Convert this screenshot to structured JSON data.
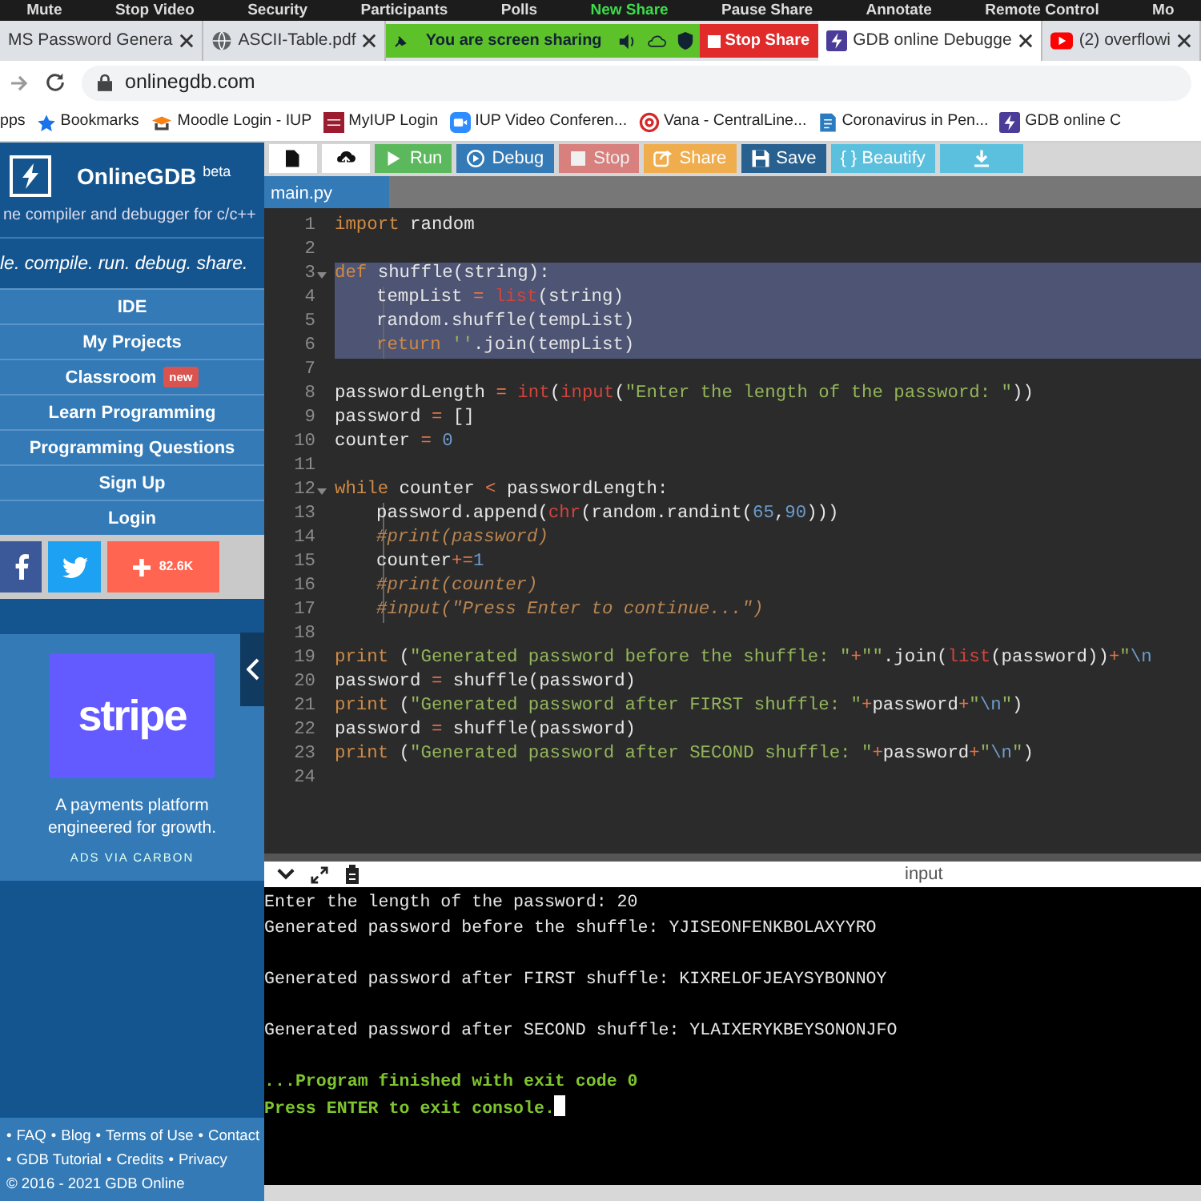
{
  "zoom_toolbar": {
    "items": [
      {
        "label": "Mute",
        "highlighted": false
      },
      {
        "label": "Stop Video",
        "highlighted": false
      },
      {
        "label": "Security",
        "highlighted": false
      },
      {
        "label": "Participants",
        "highlighted": false
      },
      {
        "label": "Polls",
        "highlighted": false
      },
      {
        "label": "New Share",
        "highlighted": true
      },
      {
        "label": "Pause Share",
        "highlighted": false
      },
      {
        "label": "Annotate",
        "highlighted": false
      },
      {
        "label": "Remote Control",
        "highlighted": false
      },
      {
        "label": "Mo",
        "highlighted": false
      }
    ]
  },
  "browser": {
    "tabs": [
      {
        "title": "MS Password Genera",
        "selected": false
      },
      {
        "title": "ASCII-Table.pdf",
        "selected": false
      },
      {
        "title": "GDB online Debugge",
        "selected": true
      },
      {
        "title": "(2) overflowi",
        "selected": false
      }
    ],
    "sharing_banner": {
      "message": "You are screen sharing",
      "stop_label": "Stop Share"
    },
    "address": {
      "url": "onlinegdb.com"
    },
    "bookmarks": [
      {
        "label": "pps"
      },
      {
        "label": "Bookmarks"
      },
      {
        "label": "Moodle Login - IUP"
      },
      {
        "label": "MyIUP Login"
      },
      {
        "label": "IUP Video Conferen..."
      },
      {
        "label": "Vana - CentralLine..."
      },
      {
        "label": "Coronavirus in Pen..."
      },
      {
        "label": "GDB online C"
      }
    ]
  },
  "sidebar": {
    "brand": "OnlineGDB $^{beta}$",
    "subtitle": "ne compiler and debugger for c/c++",
    "tagline": "le. compile. run. debug. share.",
    "menu": [
      {
        "label": "IDE"
      },
      {
        "label": "My Projects"
      },
      {
        "label": "Classroom",
        "tag": "new"
      },
      {
        "label": "Learn Programming"
      },
      {
        "label": "Programming Questions"
      },
      {
        "label": "Sign Up"
      },
      {
        "label": "Login"
      }
    ],
    "share_count": "82.6K",
    "ad": {
      "logo": "stripe",
      "text": "A payments platform engineered for growth.",
      "via": "ADS VIA CARBON"
    },
    "footer": {
      "bullet": "•",
      "rows": [
        {
          "links": [
            "FAQ",
            "Blog",
            "Terms of Use",
            "Contact"
          ]
        },
        {
          "links": [
            "GDB Tutorial",
            "Credits",
            "Privacy"
          ]
        }
      ],
      "copyright": "© 2016 - 2021 GDB Online"
    }
  },
  "editor": {
    "toolbar": [
      {
        "kind": "new",
        "disabled": false
      },
      {
        "kind": "upload",
        "disabled": false
      },
      {
        "kind": "run",
        "label": "Run",
        "disabled": false
      },
      {
        "kind": "debug",
        "label": "Debug",
        "disabled": false
      },
      {
        "kind": "stop",
        "label": "Stop",
        "disabled": true
      },
      {
        "kind": "share",
        "label": "Share",
        "disabled": false
      },
      {
        "kind": "save",
        "label": "Save",
        "disabled": false
      },
      {
        "kind": "beautify",
        "label": "{ } Beautify",
        "disabled": false
      },
      {
        "kind": "download",
        "disabled": false
      }
    ],
    "file_tabs": [
      {
        "name": "main.py",
        "selected": true
      }
    ],
    "code": {
      "lines": [
        {
          "number": "1",
          "selected": false,
          "foldable": false,
          "indented": false,
          "tokens": [
            {
              "kind": "kw",
              "text": "import"
            },
            {
              "kind": "txt",
              "text": " random"
            }
          ]
        },
        {
          "number": "2",
          "selected": false,
          "foldable": false,
          "indented": false
        },
        {
          "number": "3",
          "selected": true,
          "foldable": true,
          "indented": false,
          "tokens": [
            {
              "kind": "kw",
              "text": "def"
            },
            {
              "kind": "txt",
              "text": " shuffle(string):"
            }
          ]
        },
        {
          "number": "4",
          "selected": true,
          "foldable": false,
          "indented": true,
          "tokens": [
            {
              "kind": "txt",
              "text": "tempList "
            },
            {
              "kind": "op",
              "text": "= "
            },
            {
              "kind": "fn",
              "text": "list"
            },
            {
              "kind": "txt",
              "text": "(string)"
            }
          ]
        },
        {
          "number": "5",
          "selected": true,
          "foldable": false,
          "indented": true,
          "tokens": [
            {
              "kind": "txt",
              "text": "random.shuffle(tempList)"
            }
          ]
        },
        {
          "number": "6",
          "selected": true,
          "foldable": false,
          "indented": true,
          "tokens": [
            {
              "kind": "kw",
              "text": "return "
            },
            {
              "kind": "str",
              "text": "''"
            },
            {
              "kind": "txt",
              "text": ".join(tempList)"
            }
          ]
        },
        {
          "number": "7",
          "selected": false,
          "foldable": false,
          "indented": false
        },
        {
          "number": "8",
          "selected": false,
          "foldable": false,
          "indented": false,
          "tokens": [
            {
              "kind": "txt",
              "text": "passwordLength "
            },
            {
              "kind": "op",
              "text": "= "
            },
            {
              "kind": "fn",
              "text": "int"
            },
            {
              "kind": "txt",
              "text": "("
            },
            {
              "kind": "fn",
              "text": "input"
            },
            {
              "kind": "txt",
              "text": "("
            },
            {
              "kind": "str",
              "text": "\"Enter the length of the password: \""
            },
            {
              "kind": "txt",
              "text": "))"
            }
          ]
        },
        {
          "number": "9",
          "selected": false,
          "foldable": false,
          "indented": false,
          "tokens": [
            {
              "kind": "txt",
              "text": "password "
            },
            {
              "kind": "op",
              "text": "="
            },
            {
              "kind": "txt",
              "text": " []"
            }
          ]
        },
        {
          "number": "10",
          "selected": false,
          "foldable": false,
          "indented": false,
          "tokens": [
            {
              "kind": "txt",
              "text": "counter "
            },
            {
              "kind": "op",
              "text": "= "
            },
            {
              "kind": "num",
              "text": "0"
            }
          ]
        },
        {
          "number": "11",
          "selected": false,
          "foldable": false,
          "indented": false
        },
        {
          "number": "12",
          "selected": false,
          "foldable": true,
          "indented": false,
          "tokens": [
            {
              "kind": "kw",
              "text": "while"
            },
            {
              "kind": "txt",
              "text": " counter "
            },
            {
              "kind": "op",
              "text": "<"
            },
            {
              "kind": "txt",
              "text": " passwordLength:"
            }
          ]
        },
        {
          "number": "13",
          "selected": false,
          "foldable": false,
          "indented": true,
          "tokens": [
            {
              "kind": "txt",
              "text": "password.append("
            },
            {
              "kind": "fn",
              "text": "chr"
            },
            {
              "kind": "txt",
              "text": "(random.randint("
            },
            {
              "kind": "num",
              "text": "65"
            },
            {
              "kind": "txt",
              "text": ","
            },
            {
              "kind": "num",
              "text": "90"
            },
            {
              "kind": "txt",
              "text": ")))"
            }
          ]
        },
        {
          "number": "14",
          "selected": false,
          "foldable": false,
          "indented": true,
          "tokens": [
            {
              "kind": "com",
              "text": "#print(password)"
            }
          ]
        },
        {
          "number": "15",
          "selected": false,
          "foldable": false,
          "indented": true,
          "tokens": [
            {
              "kind": "txt",
              "text": "counter"
            },
            {
              "kind": "op",
              "text": "+="
            },
            {
              "kind": "num",
              "text": "1"
            }
          ]
        },
        {
          "number": "16",
          "selected": false,
          "foldable": false,
          "indented": true,
          "tokens": [
            {
              "kind": "com",
              "text": "#print(counter)"
            }
          ]
        },
        {
          "number": "17",
          "selected": false,
          "foldable": false,
          "indented": true,
          "tokens": [
            {
              "kind": "com",
              "text": "#input(\"Press Enter to continue...\")"
            }
          ]
        },
        {
          "number": "18",
          "selected": false,
          "foldable": false,
          "indented": false
        },
        {
          "number": "19",
          "selected": false,
          "foldable": false,
          "indented": false,
          "tokens": [
            {
              "kind": "kw",
              "text": "print"
            },
            {
              "kind": "txt",
              "text": " ("
            },
            {
              "kind": "str",
              "text": "\"Generated password before the shuffle: \""
            },
            {
              "kind": "op",
              "text": "+"
            },
            {
              "kind": "str",
              "text": "\"\""
            },
            {
              "kind": "txt",
              "text": ".join("
            },
            {
              "kind": "fn",
              "text": "list"
            },
            {
              "kind": "txt",
              "text": "(password))"
            },
            {
              "kind": "op",
              "text": "+"
            },
            {
              "kind": "str",
              "text": "\""
            },
            {
              "kind": "esc",
              "text": "\\n"
            }
          ]
        },
        {
          "number": "20",
          "selected": false,
          "foldable": false,
          "indented": false,
          "tokens": [
            {
              "kind": "txt",
              "text": "password "
            },
            {
              "kind": "op",
              "text": "="
            },
            {
              "kind": "txt",
              "text": " shuffle(password)"
            }
          ]
        },
        {
          "number": "21",
          "selected": false,
          "foldable": false,
          "indented": false,
          "tokens": [
            {
              "kind": "kw",
              "text": "print"
            },
            {
              "kind": "txt",
              "text": " ("
            },
            {
              "kind": "str",
              "text": "\"Generated password after FIRST shuffle: \""
            },
            {
              "kind": "op",
              "text": "+"
            },
            {
              "kind": "txt",
              "text": "password"
            },
            {
              "kind": "op",
              "text": "+"
            },
            {
              "kind": "str",
              "text": "\""
            },
            {
              "kind": "esc",
              "text": "\\n"
            },
            {
              "kind": "str",
              "text": "\""
            },
            {
              "kind": "txt",
              "text": ")"
            }
          ]
        },
        {
          "number": "22",
          "selected": false,
          "foldable": false,
          "indented": false,
          "tokens": [
            {
              "kind": "txt",
              "text": "password "
            },
            {
              "kind": "op",
              "text": "="
            },
            {
              "kind": "txt",
              "text": " shuffle(password)"
            }
          ]
        },
        {
          "number": "23",
          "selected": false,
          "foldable": false,
          "indented": false,
          "tokens": [
            {
              "kind": "kw",
              "text": "print"
            },
            {
              "kind": "txt",
              "text": " ("
            },
            {
              "kind": "str",
              "text": "\"Generated password after SECOND shuffle: \""
            },
            {
              "kind": "op",
              "text": "+"
            },
            {
              "kind": "txt",
              "text": "password"
            },
            {
              "kind": "op",
              "text": "+"
            },
            {
              "kind": "str",
              "text": "\""
            },
            {
              "kind": "esc",
              "text": "\\n"
            },
            {
              "kind": "str",
              "text": "\""
            },
            {
              "kind": "txt",
              "text": ")"
            }
          ]
        },
        {
          "number": "24",
          "selected": false,
          "foldable": false,
          "indented": false
        }
      ]
    },
    "console": {
      "label": "input",
      "lines": [
        {
          "kind": "output",
          "text": "Enter the length of the password: 20",
          "gap_before": false,
          "cursor": false
        },
        {
          "kind": "output",
          "text": "Generated password before the shuffle: YJISEONFENKBOLAXYYRO",
          "gap_before": false,
          "cursor": false
        },
        {
          "kind": "output",
          "text": "Generated password after FIRST shuffle: KIXRELOFJEAYSYBONNOY",
          "gap_before": true,
          "cursor": false
        },
        {
          "kind": "output",
          "text": "Generated password after SECOND shuffle: YLAIXERYKBEYSONONJFO",
          "gap_before": true,
          "cursor": false
        },
        {
          "kind": "status",
          "text": "...Program finished with exit code 0",
          "gap_before": true,
          "cursor": false
        },
        {
          "kind": "status",
          "text": "Press ENTER to exit console.",
          "gap_before": false,
          "cursor": true
        }
      ]
    }
  }
}
